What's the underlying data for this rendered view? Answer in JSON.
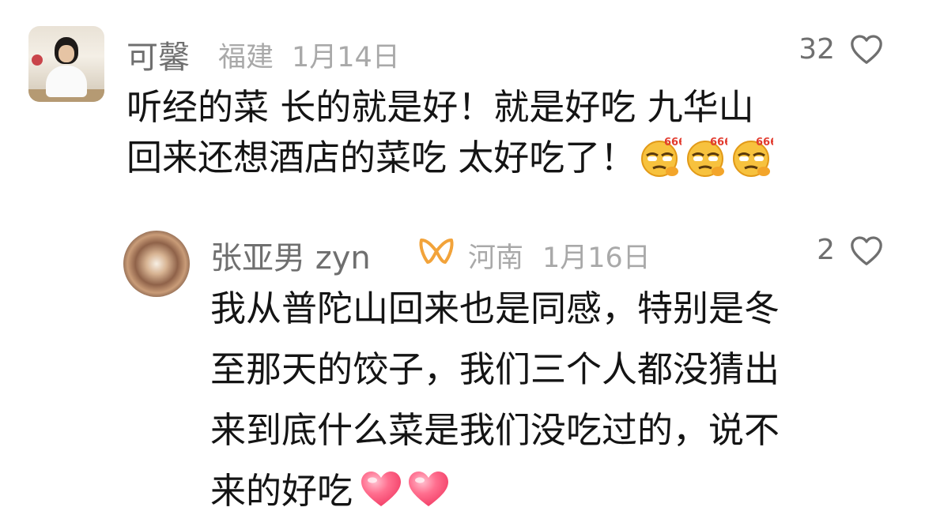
{
  "comments": [
    {
      "user": "可馨",
      "location": "福建",
      "date": "1月14日",
      "likes": "32",
      "text_line1": "听经的菜 长的就是好！就是好吃 九华山",
      "text_line2": "回来还想酒店的菜吃 太好吃了！",
      "emoji": "666-smug-emoji"
    },
    {
      "user": "张亚男 zyn",
      "location": "河南",
      "date": "1月16日",
      "likes": "2",
      "text_line1": "我从普陀山回来也是同感，特别是冬",
      "text_line2": "至那天的饺子，我们三个人都没猜出",
      "text_line3": "来到底什么菜是我们没吃过的，说不",
      "text_line4": "来的好吃",
      "emoji": "red-heart-emoji",
      "badge_icon": "creator-badge-icon"
    }
  ],
  "colors": {
    "name": "#6f6f6f",
    "meta": "#a9a9a9",
    "text": "#141414",
    "badge": "#f2a33a",
    "heart_emoji": "#ff5a7a"
  }
}
